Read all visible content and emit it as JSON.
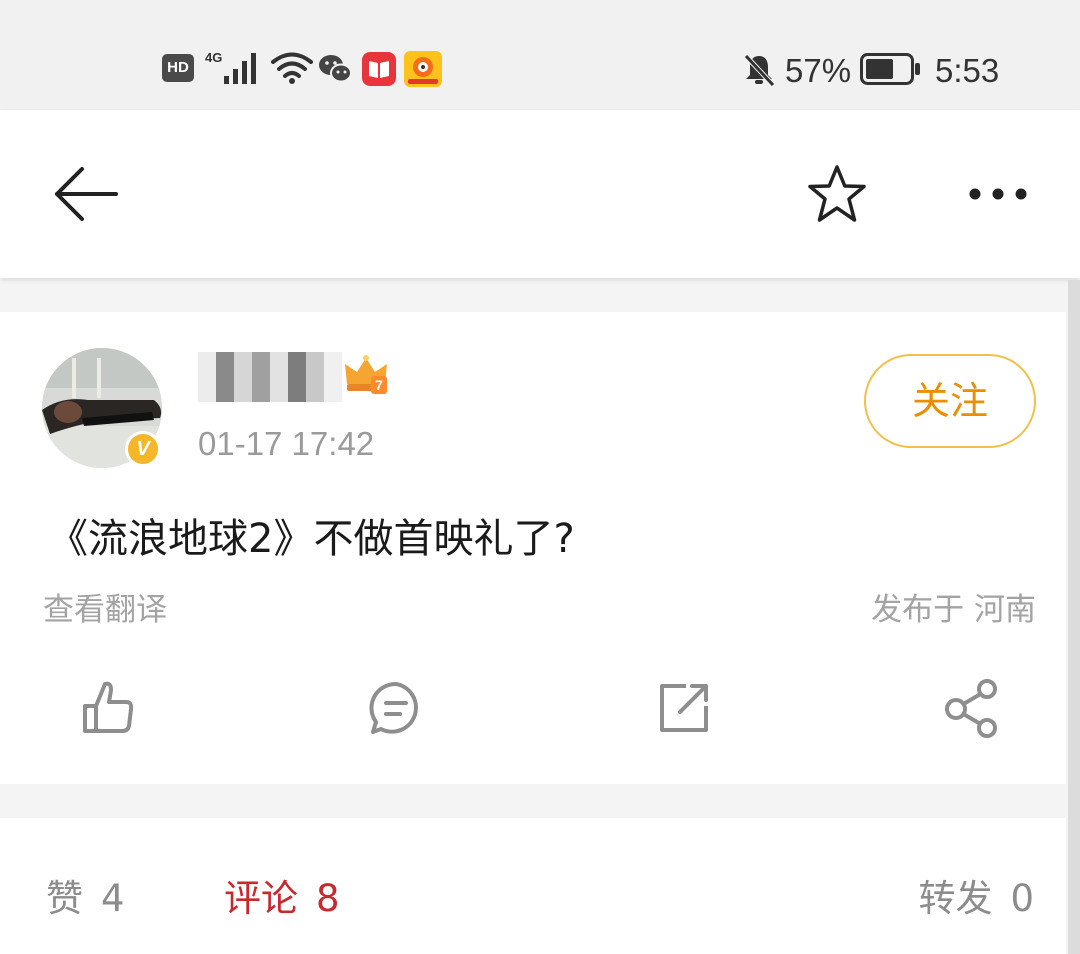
{
  "status_bar": {
    "hd_label": "HD",
    "network_label": "4G",
    "battery_percent": "57%",
    "time": "5:53",
    "battery_level": 0.57
  },
  "nav": {
    "icons": [
      "back-arrow-icon",
      "star-icon",
      "more-icon"
    ]
  },
  "post": {
    "timestamp": "01-17 17:42",
    "follow_label": "关注",
    "content": "《流浪地球2》不做首映礼了?",
    "translate_label": "查看翻译",
    "location_label": "发布于 河南",
    "verified_badge": "V",
    "level_badge": "7",
    "actions": [
      "like-icon",
      "comment-icon",
      "repost-icon",
      "share-icon"
    ]
  },
  "stats": {
    "likes_label": "赞",
    "likes_count": "4",
    "comments_label": "评论",
    "comments_count": "8",
    "reposts_label": "转发",
    "reposts_count": "0"
  },
  "colors": {
    "accent_orange": "#eb8e00",
    "follow_border": "#f0c04a",
    "active_red": "#c9282d",
    "muted_gray": "#9a9a9a"
  }
}
